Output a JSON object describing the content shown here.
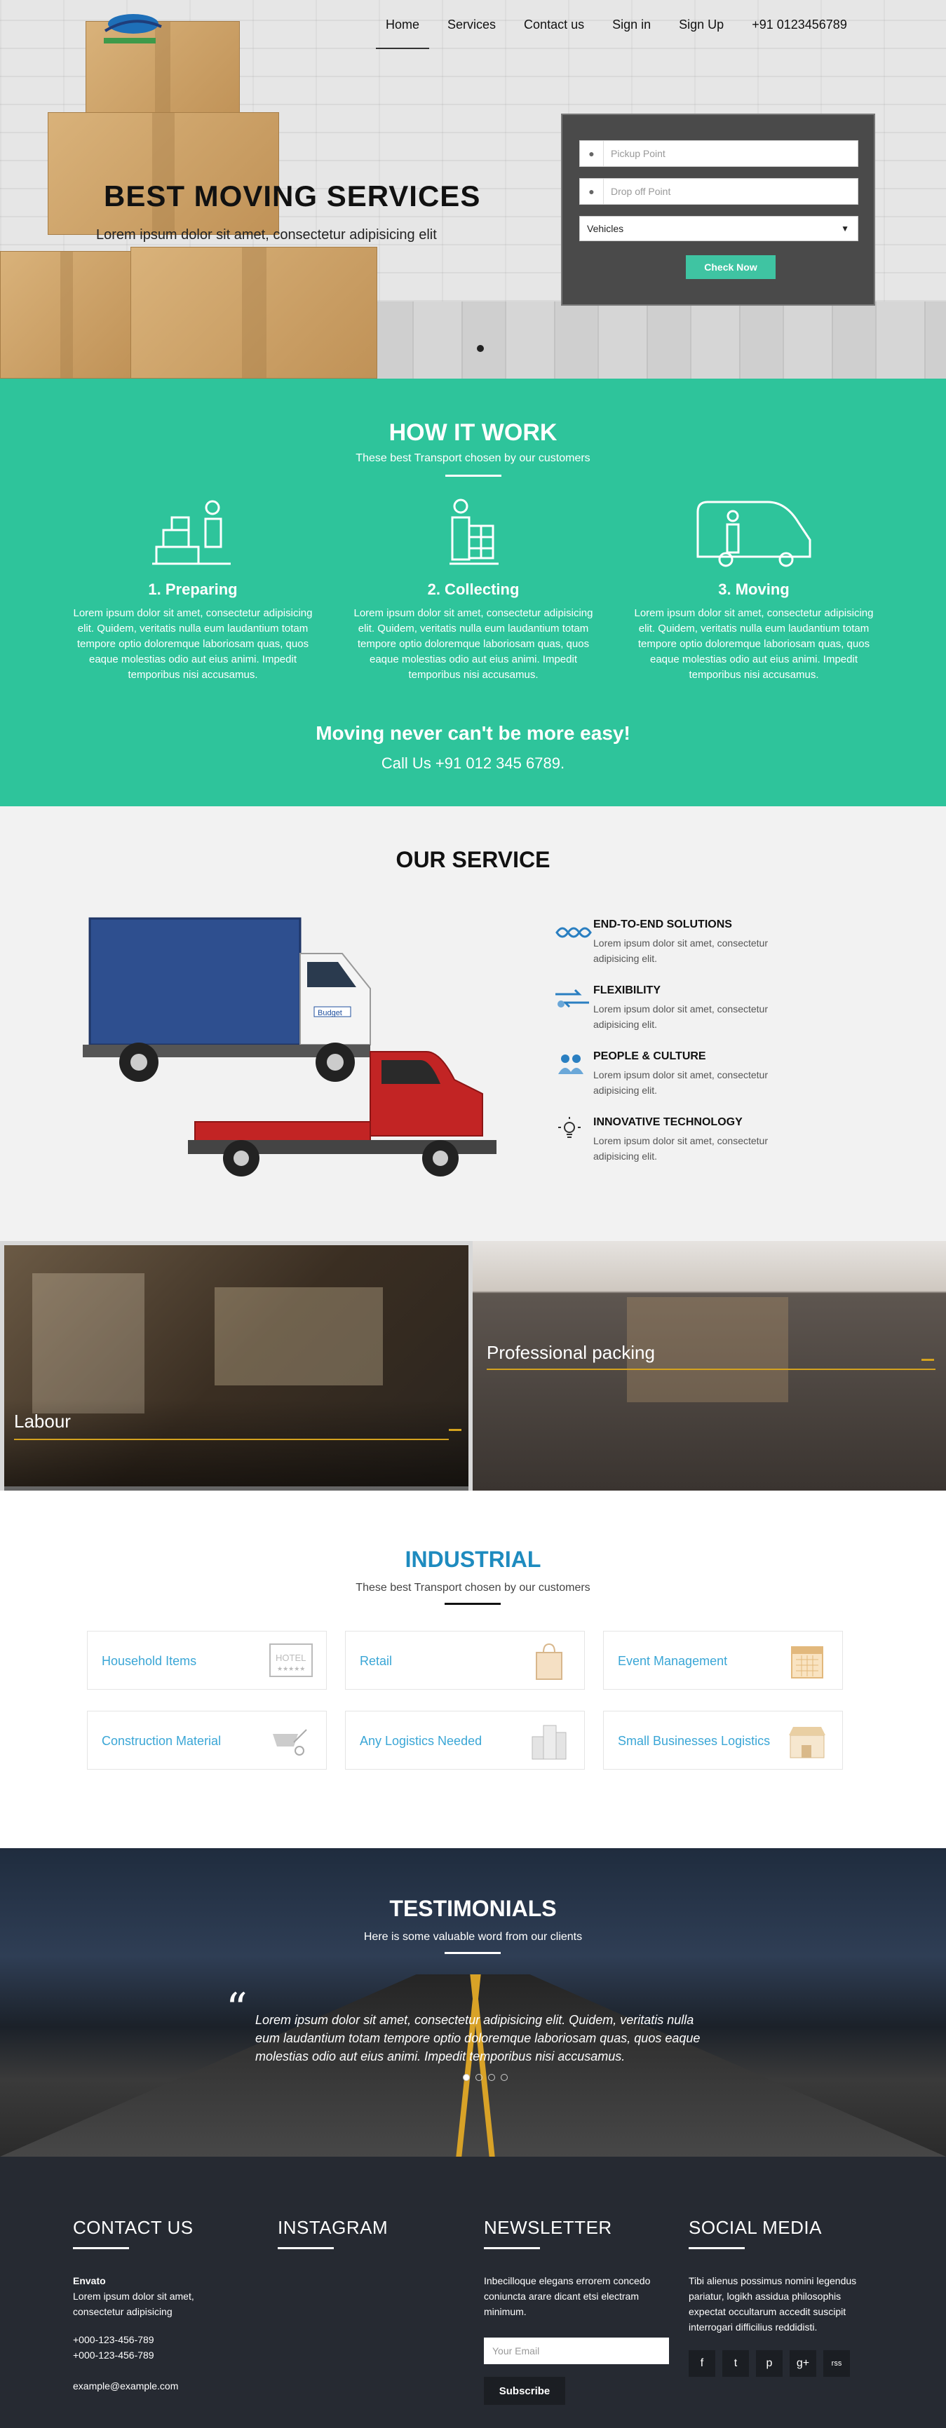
{
  "nav": {
    "items": [
      "Home",
      "Services",
      "Contact us",
      "Sign in",
      "Sign Up",
      "+91 0123456789"
    ],
    "active": "Home"
  },
  "hero": {
    "title": "BEST MOVING SERVICES",
    "subtitle": "Lorem ipsum dolor sit amet, consectetur adipisicing elit",
    "pickup_placeholder": "Pickup Point",
    "drop_placeholder": "Drop off Point",
    "vehicle_select": "Vehicles",
    "check_button": "Check Now"
  },
  "how": {
    "title": "HOW IT WORK",
    "subtitle": "These best Transport chosen by our customers",
    "steps": [
      {
        "title": "1. Preparing",
        "text": "Lorem ipsum dolor sit amet, consectetur adipisicing elit. Quidem, veritatis nulla eum laudantium totam tempore optio doloremque laboriosam quas, quos eaque molestias odio aut eius animi. Impedit temporibus nisi accusamus."
      },
      {
        "title": "2. Collecting",
        "text": "Lorem ipsum dolor sit amet, consectetur adipisicing elit. Quidem, veritatis nulla eum laudantium totam tempore optio doloremque laboriosam quas, quos eaque molestias odio aut eius animi. Impedit temporibus nisi accusamus."
      },
      {
        "title": "3. Moving",
        "text": "Lorem ipsum dolor sit amet, consectetur adipisicing elit. Quidem, veritatis nulla eum laudantium totam tempore optio doloremque laboriosam quas, quos eaque molestias odio aut eius animi. Impedit temporibus nisi accusamus."
      }
    ],
    "tagline": "Moving never can't be more easy!",
    "call": "Call Us +91 012 345 6789."
  },
  "service": {
    "title": "OUR SERVICE",
    "items": [
      {
        "title": "END-TO-END SOLUTIONS",
        "text": "Lorem ipsum dolor sit amet, consectetur adipisicing elit."
      },
      {
        "title": "FLEXIBILITY",
        "text": "Lorem ipsum dolor sit amet, consectetur adipisicing elit."
      },
      {
        "title": "PEOPLE & CULTURE",
        "text": "Lorem ipsum dolor sit amet, consectetur adipisicing elit."
      },
      {
        "title": "INNOVATIVE TECHNOLOGY",
        "text": "Lorem ipsum dolor sit amet, consectetur adipisicing elit."
      }
    ],
    "truck_badge": "Budget"
  },
  "photos": {
    "left_caption": "Labour",
    "right_caption": "Professional packing"
  },
  "industrial": {
    "title": "INDUSTRIAL",
    "subtitle": "These best Transport chosen by our customers",
    "cards": [
      "Household Items",
      "Retail",
      "Event Management",
      "Construction Material",
      "Any Logistics Needed",
      "Small Businesses Logistics"
    ],
    "hotel_sign": "HOTEL"
  },
  "testimonials": {
    "title": "TESTIMONIALS",
    "subtitle": "Here is some valuable word from our clients",
    "quote_mark": "“",
    "quote": "Lorem ipsum dolor sit amet, consectetur adipisicing elit. Quidem, veritatis nulla eum laudantium totam tempore optio doloremque laboriosam quas, quos eaque molestias odio aut eius animi. Impedit temporibus nisi accusamus."
  },
  "footer": {
    "contact": {
      "title": "CONTACT US",
      "company": "Envato",
      "address": "Lorem ipsum dolor sit amet, consectetur adipisicing",
      "phone1": "+000-123-456-789",
      "phone2": "+000-123-456-789",
      "email": "example@example.com"
    },
    "instagram": {
      "title": "INSTAGRAM"
    },
    "newsletter": {
      "title": "NEWSLETTER",
      "text": "Inbecilloque elegans errorem concedo coniuncta arare dicant etsi electram minimum.",
      "placeholder": "Your Email",
      "button": "Subscribe"
    },
    "social": {
      "title": "SOCIAL MEDIA",
      "text": "Tibi alienus possimus nomini legendus pariatur, logikh assidua philosophis expectat occultarum accedit suscipit interrogari difficilius reddidisti.",
      "icons": [
        "f",
        "t",
        "p",
        "g+",
        "rss"
      ]
    }
  },
  "colors": {
    "teal": "#2ec49b",
    "button": "#3fc4a2",
    "industrial_blue": "#1e8bbf",
    "accent_gold": "#d4a21e",
    "footer_bg": "#262a32"
  }
}
